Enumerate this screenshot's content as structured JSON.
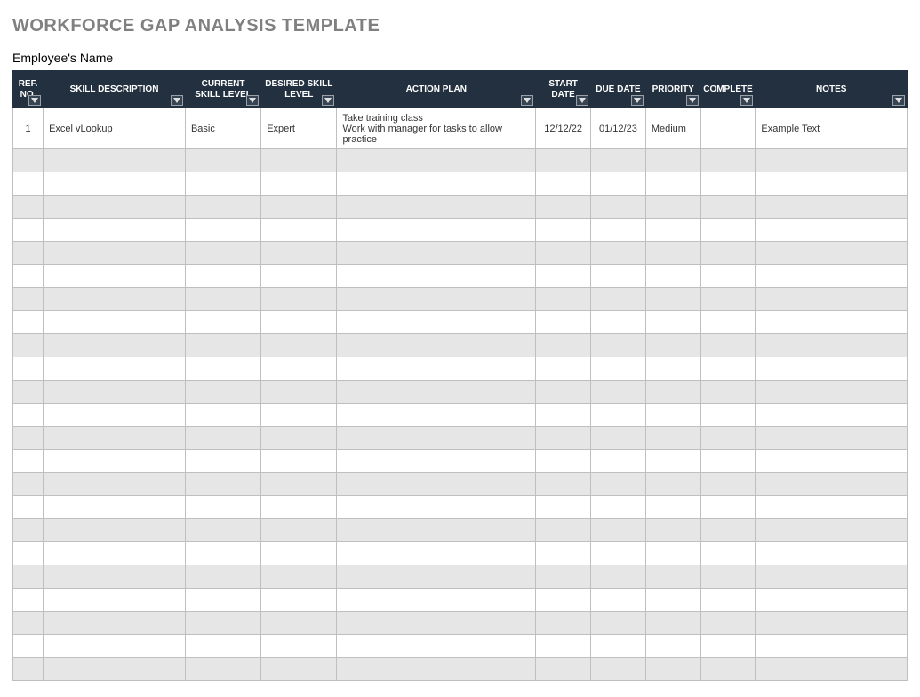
{
  "title": "WORKFORCE GAP ANALYSIS TEMPLATE",
  "subtitle": "Employee's Name",
  "headers": {
    "ref": "REF. NO.",
    "skill": "SKILL DESCRIPTION",
    "current": "CURRENT SKILL LEVEL",
    "desired": "DESIRED SKILL LEVEL",
    "action": "ACTION PLAN",
    "start": "START DATE",
    "due": "DUE DATE",
    "priority": "PRIORITY",
    "complete": "COMPLETE",
    "notes": "NOTES"
  },
  "rows": [
    {
      "ref": "1",
      "skill": "Excel vLookup",
      "current": "Basic",
      "desired": "Expert",
      "action": "Take training class\nWork with manager for tasks to allow practice",
      "start": "12/12/22",
      "due": "01/12/23",
      "priority": "Medium",
      "complete": "",
      "notes": "Example Text"
    }
  ],
  "empty_row_count": 23
}
